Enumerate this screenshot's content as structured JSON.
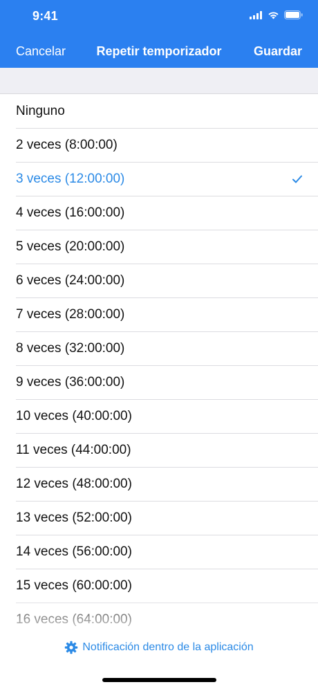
{
  "status_bar": {
    "time": "9:41",
    "icons": [
      "cellular-signal-icon",
      "wifi-icon",
      "battery-icon"
    ]
  },
  "nav": {
    "cancel_label": "Cancelar",
    "title": "Repetir temporizador",
    "save_label": "Guardar"
  },
  "options": [
    "Ninguno",
    "2 veces (8:00:00)",
    "3 veces (12:00:00)",
    "4 veces (16:00:00)",
    "5 veces (20:00:00)",
    "6 veces (24:00:00)",
    "7 veces (28:00:00)",
    "8 veces (32:00:00)",
    "9 veces (36:00:00)",
    "10 veces (40:00:00)",
    "11 veces (44:00:00)",
    "12 veces (48:00:00)",
    "13 veces (52:00:00)",
    "14 veces (56:00:00)",
    "15 veces (60:00:00)",
    "16 veces (64:00:00)"
  ],
  "selected_option": "3 veces (12:00:00)",
  "footer": {
    "link_label": "Notificación dentro de la aplicación",
    "icon": "gear-icon"
  },
  "colors": {
    "header_background": "#2b80f0",
    "accent": "#2b8ae6",
    "section_background": "#efeff4"
  }
}
